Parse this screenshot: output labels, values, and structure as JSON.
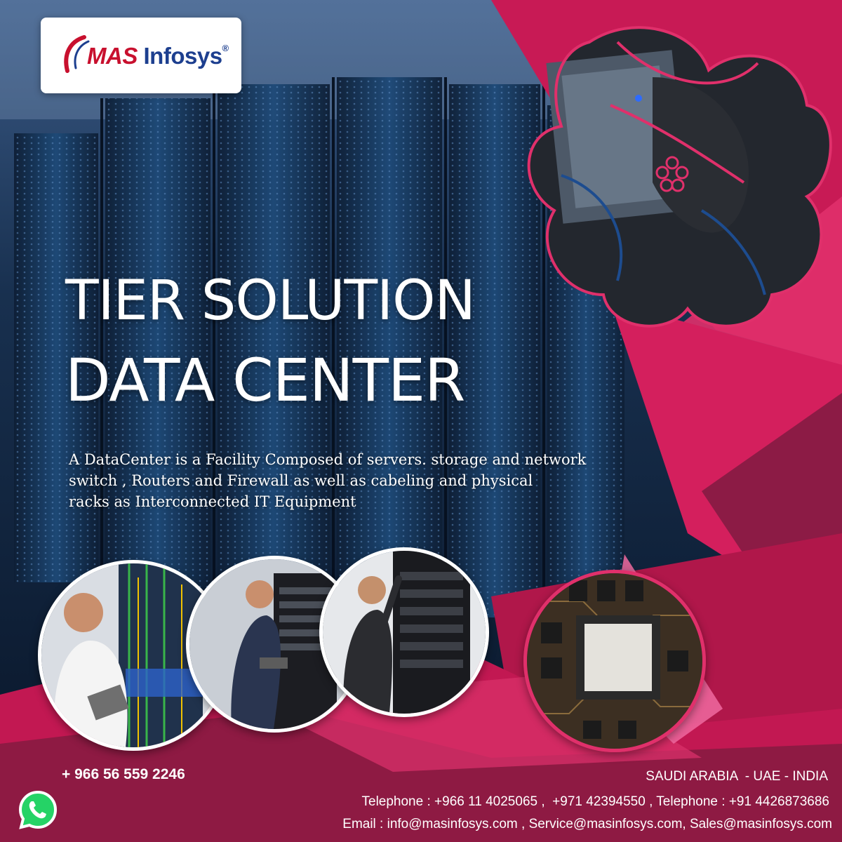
{
  "brand": {
    "logo_prefix": "MAS",
    "logo_suffix": " Infosys",
    "registered_mark": "®"
  },
  "headline": {
    "line1": "TIER SOLUTION",
    "line2": "DATA CENTER"
  },
  "description": {
    "line1": "A DataCenter is a Facility Composed of servers. storage and network",
    "line2": "switch , Routers and Firewall as well as cabeling and physical",
    "line3": "racks as Interconnected IT Equipment"
  },
  "contact": {
    "whatsapp_number": "+ 966 56 559 2246",
    "countries": "SAUDI ARABIA  - UAE - INDIA",
    "telephone": "Telephone : +966 11 4025065 ,  +971 42394550 , Telephone : +91 4426873686",
    "email": "Email : info@masinfosys.com , Service@masinfosys.com, Sales@masinfosys.com"
  },
  "colors": {
    "brand_red": "#c8102e",
    "brand_blue": "#1d3f8f",
    "magenta": "#d41f5d",
    "dark_magenta": "#8c1b45",
    "navy": "#0c1d33",
    "whatsapp_green": "#25d366"
  }
}
